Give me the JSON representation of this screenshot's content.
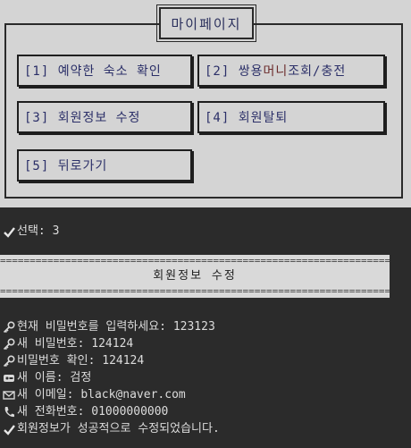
{
  "menu": {
    "title": "마이페이지",
    "buttons": [
      {
        "label": "[1] 예약한 숙소 확인"
      },
      {
        "label_a": "[2] 쌍용 ",
        "label_hl": "머니",
        "label_b": " 조회/충전"
      },
      {
        "label": "[3] 회원정보 수정"
      },
      {
        "label": "[4] 회원탈퇴"
      },
      {
        "label": "[5] 뒤로가기"
      }
    ]
  },
  "console": {
    "selection": "선택: 3",
    "separator": "==============================================================================",
    "section_title": "회원정보 수정",
    "lines": [
      {
        "icon": "key-icon",
        "text": "현재 비밀번호를 입력하세요: 123123"
      },
      {
        "icon": "key-icon",
        "text": "새 비밀번호: 124124"
      },
      {
        "icon": "key-icon",
        "text": "비밀번호 확인: 124124"
      },
      {
        "icon": "id-card-icon",
        "text": "새 이름: 검정"
      },
      {
        "icon": "envelope-icon",
        "text": "새 이메일: black@naver.com"
      },
      {
        "icon": "phone-icon",
        "text": "새 전화번호: 01000000000"
      },
      {
        "icon": "check-icon",
        "text": "회원정보가 성공적으로 수정되었습니다."
      }
    ]
  },
  "colors": {
    "panel_bg": "#d4d4d4",
    "console_bg": "#2b2b2b",
    "button_text": "#2b2f68",
    "highlight": "#6b2b2b"
  }
}
